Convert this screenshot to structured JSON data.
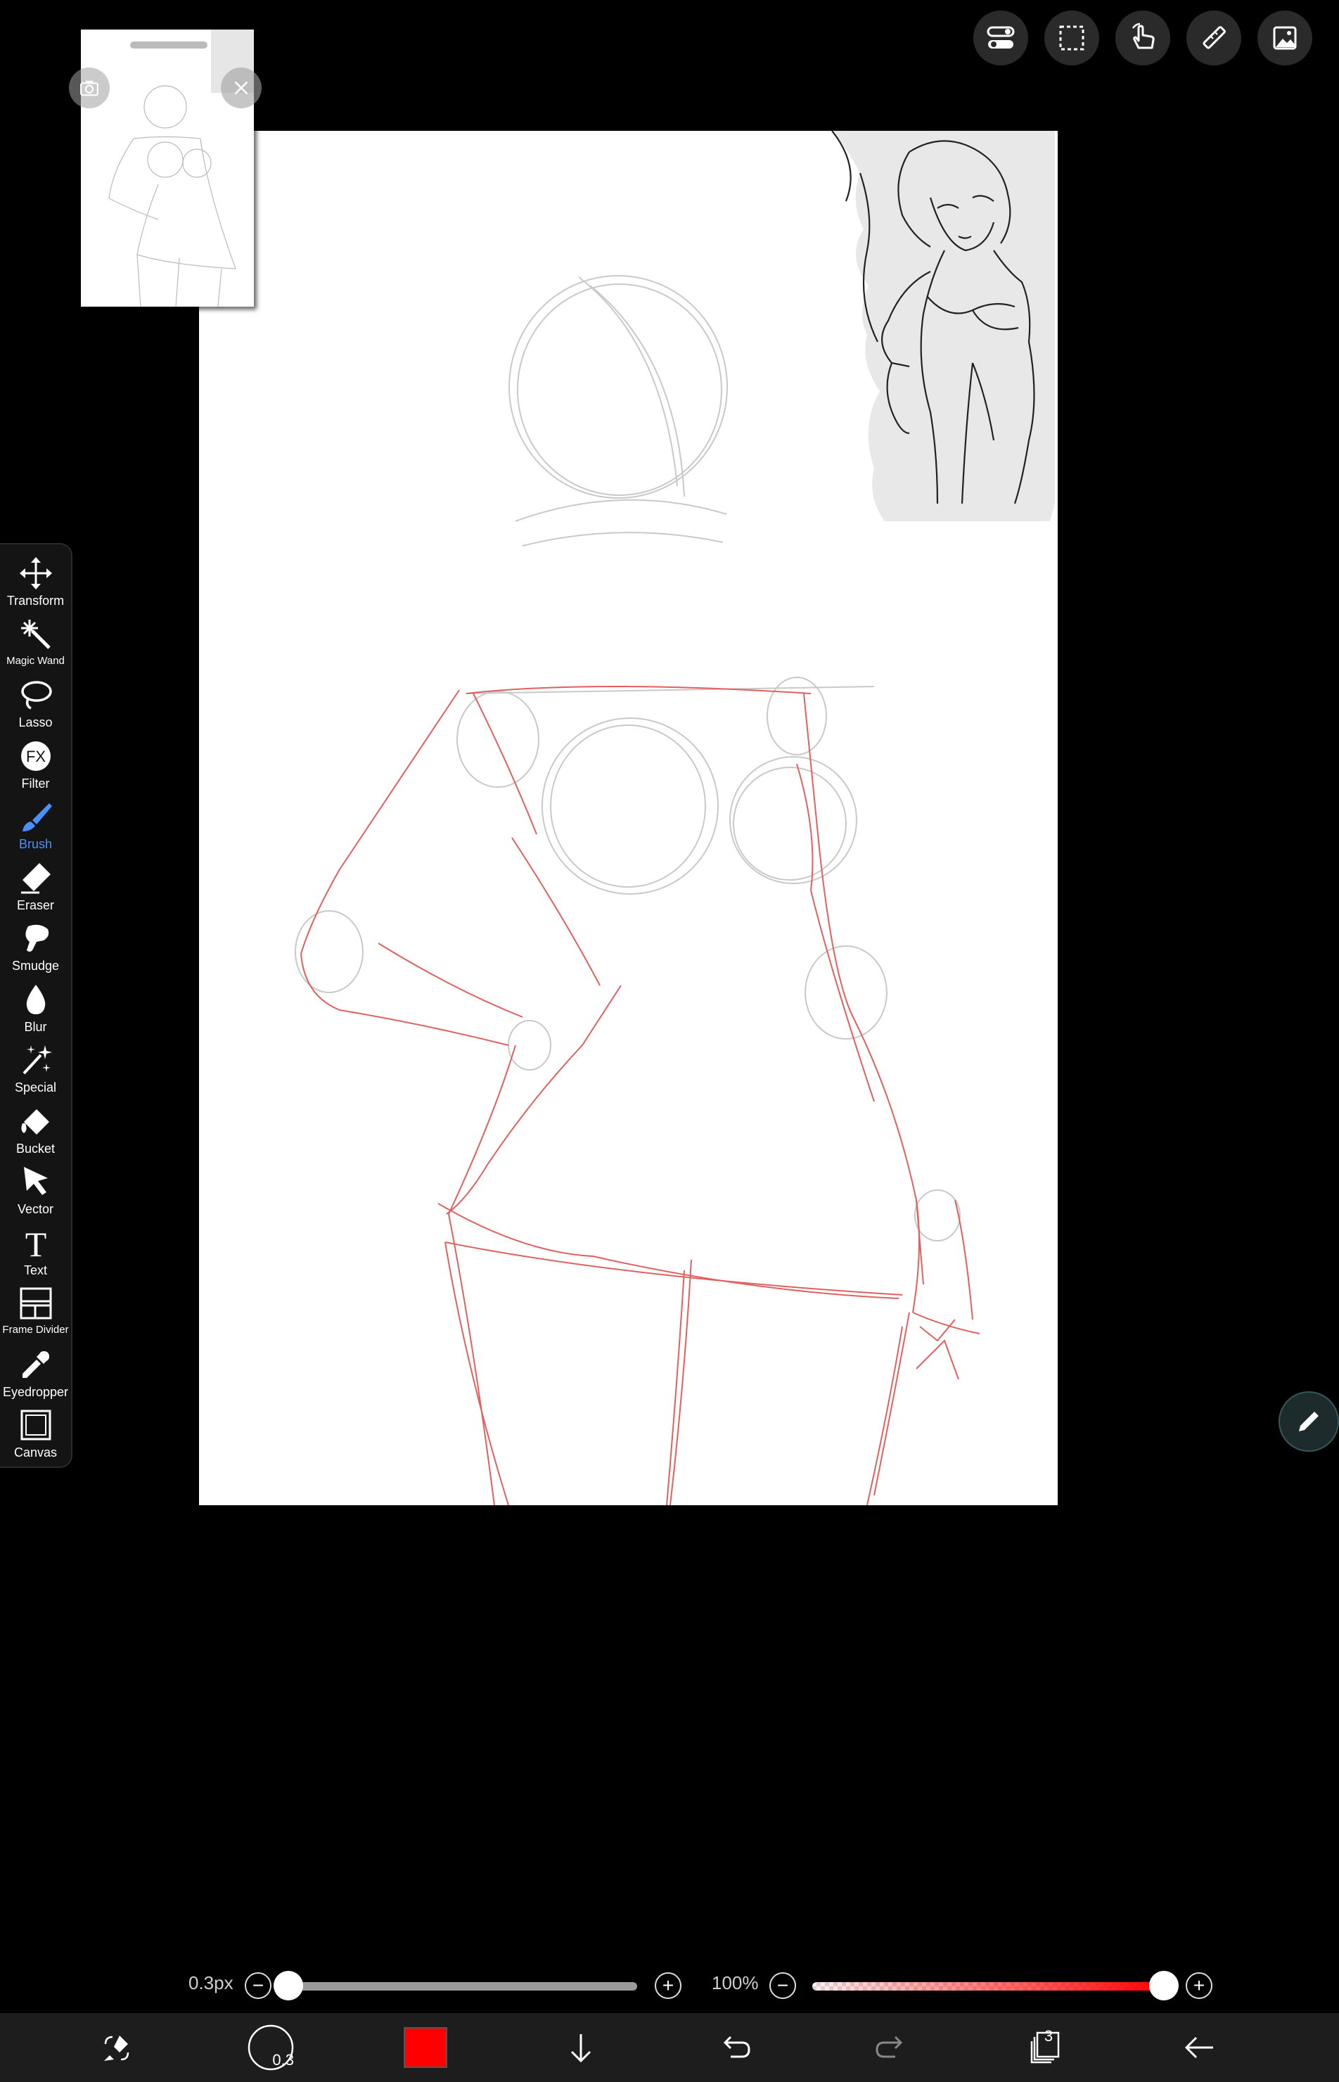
{
  "top_toolbar": {
    "icons": [
      "settings-toggle-icon",
      "selection-icon",
      "hand-gesture-icon",
      "ruler-icon",
      "material-icon"
    ]
  },
  "navigator": {
    "icons": [
      "camera-icon",
      "close-icon"
    ]
  },
  "tools": [
    {
      "label": "Transform",
      "icon": "move-arrows-icon"
    },
    {
      "label": "Magic Wand",
      "icon": "magic-wand-icon"
    },
    {
      "label": "Lasso",
      "icon": "lasso-icon"
    },
    {
      "label": "Filter",
      "icon": "fx-icon"
    },
    {
      "label": "Brush",
      "icon": "brush-icon",
      "active": true
    },
    {
      "label": "Eraser",
      "icon": "eraser-icon"
    },
    {
      "label": "Smudge",
      "icon": "smudge-icon"
    },
    {
      "label": "Blur",
      "icon": "drop-icon"
    },
    {
      "label": "Special",
      "icon": "sparkle-icon"
    },
    {
      "label": "Bucket",
      "icon": "bucket-icon"
    },
    {
      "label": "Vector",
      "icon": "cursor-arrow-icon"
    },
    {
      "label": "Text",
      "icon": "text-t-icon"
    },
    {
      "label": "Frame Divider",
      "icon": "frame-divider-icon"
    },
    {
      "label": "Eyedropper",
      "icon": "eyedropper-icon"
    },
    {
      "label": "Canvas",
      "icon": "canvas-square-icon"
    }
  ],
  "brush_size": {
    "value_label": "0.3px",
    "minus": "−",
    "plus": "+",
    "level": 0.0
  },
  "opacity": {
    "value_label": "100%",
    "minus": "−",
    "plus": "+",
    "level": 1.0
  },
  "bottom_bar": {
    "brush_size_badge": "0.3",
    "current_color": "#ff0000",
    "layer_count": "3",
    "icons": [
      "swap-tools-icon",
      "brush-size-icon",
      "color-swatch",
      "download-arrow-icon",
      "undo-icon",
      "redo-icon",
      "layers-icon",
      "back-arrow-icon"
    ]
  },
  "colors": {
    "accent": "#4a90ff",
    "sketch": "#e05050"
  }
}
